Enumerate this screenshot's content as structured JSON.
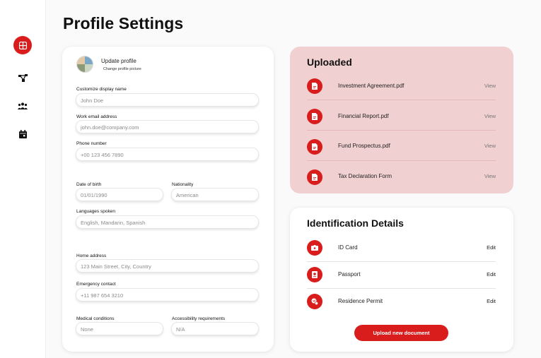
{
  "page": {
    "title": "Profile Settings"
  },
  "sidebar": {
    "items": [
      {
        "icon": "grid-icon",
        "active": true
      },
      {
        "icon": "network-icon",
        "active": false
      },
      {
        "icon": "users-icon",
        "active": false
      },
      {
        "icon": "calendar-icon",
        "active": false
      }
    ]
  },
  "profile": {
    "update_title": "Update profile",
    "change_picture": "Change profile picture",
    "fields": {
      "display_name": {
        "label": "Customize display name",
        "placeholder": "John Doe"
      },
      "email": {
        "label": "Work email address",
        "placeholder": "john.doe@company.com"
      },
      "phone": {
        "label": "Phone number",
        "placeholder": "+00 123 456 7890"
      },
      "dob": {
        "label": "Date of birth",
        "placeholder": "01/01/1990"
      },
      "nationality": {
        "label": "Nationality",
        "placeholder": "American"
      },
      "languages": {
        "label": "Languages spoken",
        "placeholder": "English, Mandarin, Spanish"
      },
      "address": {
        "label": "Home address",
        "placeholder": "123 Main Street, City, Country"
      },
      "emergency": {
        "label": "Emergency contact",
        "placeholder": "+11 987 654 3210"
      },
      "medical": {
        "label": "Medical conditions",
        "placeholder": "None"
      },
      "accessibility": {
        "label": "Accessibility requirements",
        "placeholder": "N/A"
      }
    }
  },
  "uploaded": {
    "title": "Uploaded",
    "items": [
      {
        "name": "Investment Agreement.pdf",
        "action": "View"
      },
      {
        "name": "Financial Report.pdf",
        "action": "View"
      },
      {
        "name": "Fund Prospectus.pdf",
        "action": "View"
      },
      {
        "name": "Tax Declaration Form",
        "action": "View"
      }
    ]
  },
  "identification": {
    "title": "Identification Details",
    "items": [
      {
        "name": "ID Card",
        "action": "Edit",
        "icon": "id-card-icon"
      },
      {
        "name": "Passport",
        "action": "Edit",
        "icon": "passport-icon"
      },
      {
        "name": "Residence Permit",
        "action": "Edit",
        "icon": "residence-permit-icon"
      }
    ],
    "upload_button": "Upload new document"
  },
  "colors": {
    "accent": "#d91d1d",
    "uploaded_bg": "#f0d0d0"
  }
}
